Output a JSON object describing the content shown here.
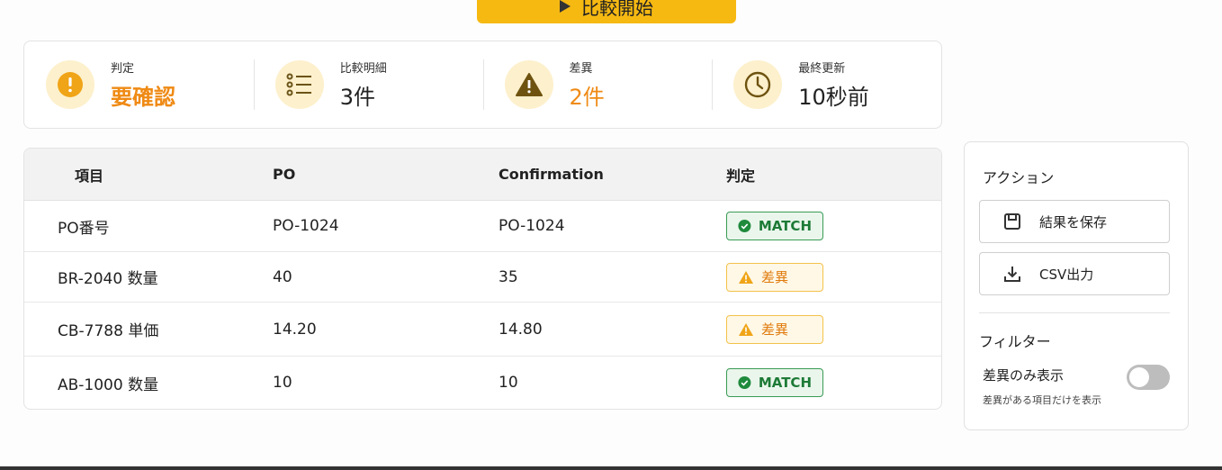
{
  "start_button": {
    "label": "比較開始",
    "icon": "play-icon"
  },
  "summary": [
    {
      "caption": "判定",
      "value": "要確認",
      "icon": "alert-circle-icon",
      "icon_color": "#f0a417",
      "value_color": "#ef8a14"
    },
    {
      "caption": "比較明細",
      "value": "3件",
      "icon": "list-icon",
      "icon_color": "#8a6d1e"
    },
    {
      "caption": "差異",
      "value": "2件",
      "icon": "warning-icon",
      "icon_color": "#7a5b10",
      "value_color": "#ef8a14"
    },
    {
      "caption": "最終更新",
      "value": "10秒前",
      "icon": "clock-icon",
      "icon_color": "#7a5b10"
    }
  ],
  "table": {
    "headers": [
      "項目",
      "PO",
      "Confirmation",
      "判定"
    ],
    "rows": [
      {
        "item": "PO番号",
        "po": "PO-1024",
        "confirmation": "PO-1024",
        "status": "MATCH",
        "type": "match"
      },
      {
        "item": "BR-2040 数量",
        "po": "40",
        "confirmation": "35",
        "status": "差異",
        "type": "diff"
      },
      {
        "item": "CB-7788 単価",
        "po": "14.20",
        "confirmation": "14.80",
        "status": "差異",
        "type": "diff"
      },
      {
        "item": "AB-1000 数量",
        "po": "10",
        "confirmation": "10",
        "status": "MATCH",
        "type": "match"
      }
    ]
  },
  "actions": {
    "title": "アクション",
    "save_label": "結果を保存",
    "save_icon": "save-icon",
    "csv_label": "CSV出力",
    "csv_icon": "download-icon"
  },
  "filter": {
    "title": "フィルター",
    "toggle_label": "差異のみ表示",
    "toggle_desc": "差異がある項目だけを表示",
    "toggle_on": false
  },
  "colors": {
    "accent": "#f6b912",
    "match": "#1d7a36",
    "diff": "#e07b0d"
  }
}
